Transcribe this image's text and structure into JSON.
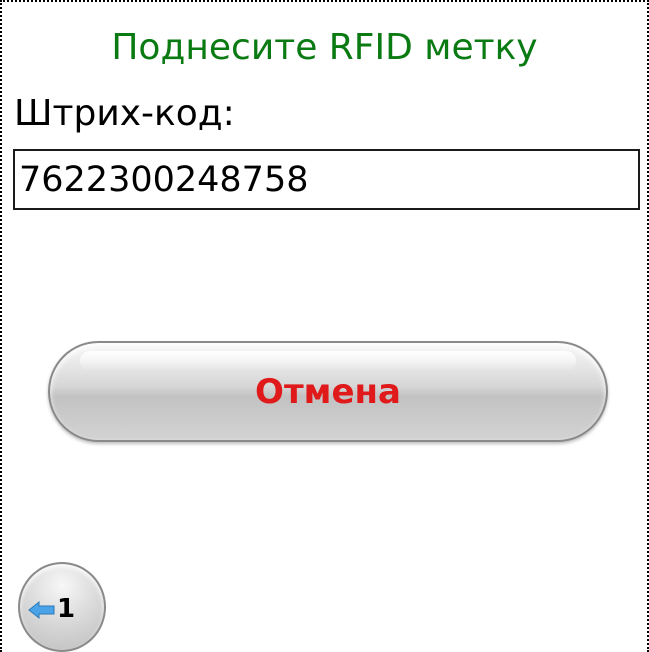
{
  "header": {
    "title": "Поднесите RFID метку"
  },
  "form": {
    "barcode_label": "Штрих-код:",
    "barcode_value": "7622300248758"
  },
  "actions": {
    "cancel_label": "Отмена",
    "page_number": "1"
  },
  "colors": {
    "title": "#0a7a12",
    "cancel_text": "#e0191b",
    "arrow": "#4aa3e6"
  },
  "icons": {
    "page_button_icon": "arrow-left-icon"
  }
}
